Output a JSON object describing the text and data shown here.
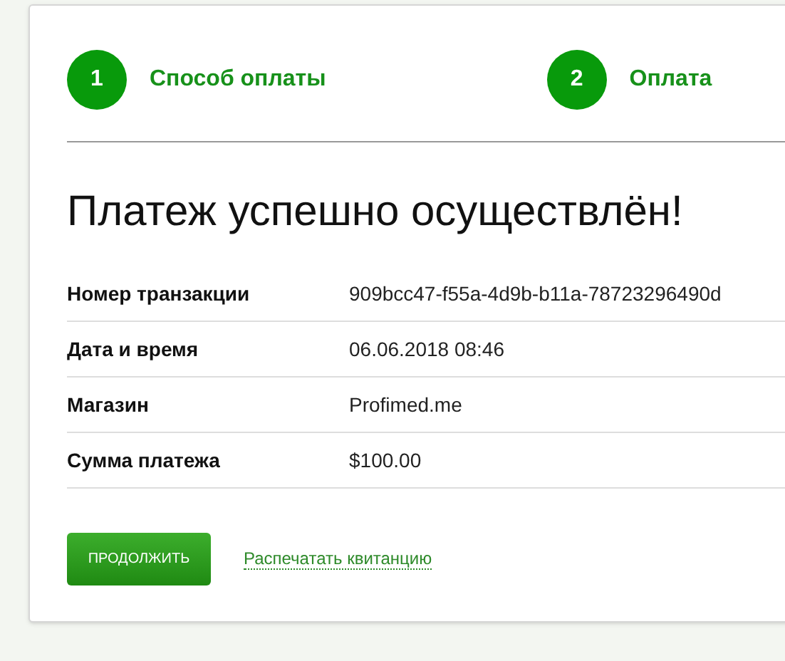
{
  "steps": [
    {
      "number": "1",
      "label": "Способ оплаты"
    },
    {
      "number": "2",
      "label": "Оплата"
    }
  ],
  "heading": "Платеж успешно осуществлён!",
  "details": [
    {
      "label": "Номер транзакции",
      "value": "909bcc47-f55a-4d9b-b11a-78723296490d"
    },
    {
      "label": "Дата и время",
      "value": "06.06.2018 08:46"
    },
    {
      "label": "Магазин",
      "value": "Profimed.me"
    },
    {
      "label": "Сумма платежа",
      "value": "$100.00"
    }
  ],
  "continue_button": "ПРОДОЛЖИТЬ",
  "print_link": "Распечатать квитанцию"
}
